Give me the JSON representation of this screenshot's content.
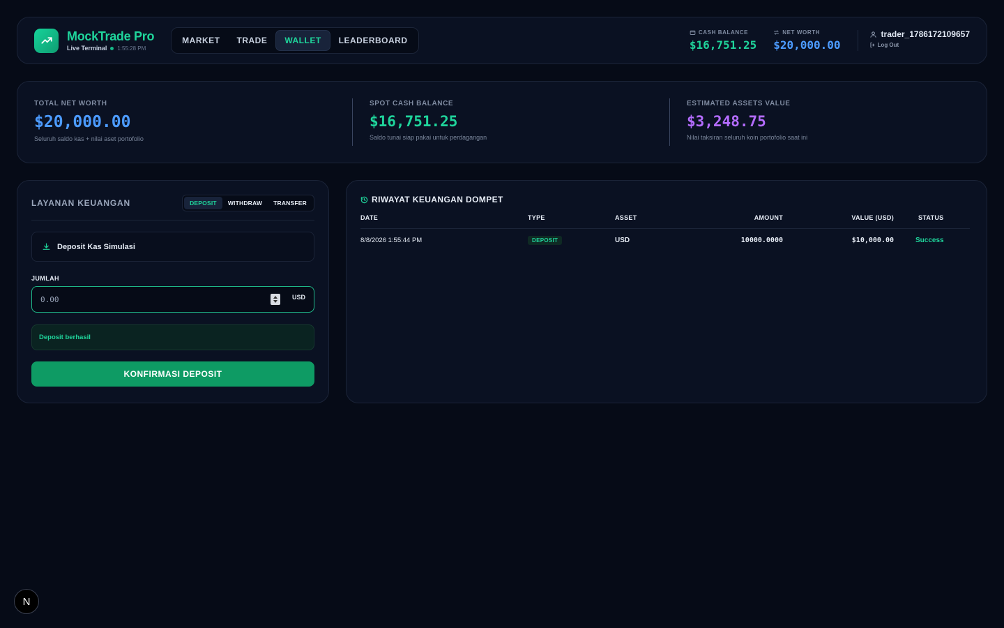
{
  "header": {
    "brand_title": "MockTrade Pro",
    "brand_sub": "Live Terminal",
    "brand_time": "1:55:28 PM",
    "nav": [
      {
        "label": "MARKET"
      },
      {
        "label": "TRADE"
      },
      {
        "label": "WALLET"
      },
      {
        "label": "LEADERBOARD"
      }
    ],
    "cash_label": "CASH BALANCE",
    "cash_value": "$16,751.25",
    "networth_label": "NET WORTH",
    "networth_value": "$20,000.00",
    "username": "trader_1786172109657",
    "logout": "Log Out"
  },
  "summary": {
    "total": {
      "label": "TOTAL NET WORTH",
      "value": "$20,000.00",
      "desc": "Seluruh saldo kas + nilai aset portofolio"
    },
    "cash": {
      "label": "SPOT CASH BALANCE",
      "value": "$16,751.25",
      "desc": "Saldo tunai siap pakai untuk perdagangan"
    },
    "assets": {
      "label": "ESTIMATED ASSETS VALUE",
      "value": "$3,248.75",
      "desc": "Nilai taksiran seluruh koin portofolio saat ini"
    }
  },
  "finance": {
    "title": "LAYANAN KEUANGAN",
    "tabs": [
      {
        "label": "DEPOSIT"
      },
      {
        "label": "WITHDRAW"
      },
      {
        "label": "TRANSFER"
      }
    ],
    "mode_label": "Deposit Kas Simulasi",
    "amount_label": "JUMLAH",
    "amount_placeholder": "0.00",
    "currency": "USD",
    "success_msg": "Deposit berhasil",
    "confirm_label": "KONFIRMASI DEPOSIT"
  },
  "history": {
    "title": "RIWAYAT KEUANGAN DOMPET",
    "columns": {
      "date": "DATE",
      "type": "TYPE",
      "asset": "ASSET",
      "amount": "AMOUNT",
      "value": "VALUE (USD)",
      "status": "STATUS"
    },
    "rows": [
      {
        "date": "8/8/2026 1:55:44 PM",
        "type": "DEPOSIT",
        "asset": "USD",
        "amount": "10000.0000",
        "value": "$10,000.00",
        "status": "Success"
      }
    ]
  },
  "misc": {
    "badge_letter": "N"
  },
  "colors": {
    "accent_green": "#1fd49b",
    "accent_blue": "#4c9bff",
    "accent_purple": "#b46cff",
    "background": "#060b17"
  }
}
